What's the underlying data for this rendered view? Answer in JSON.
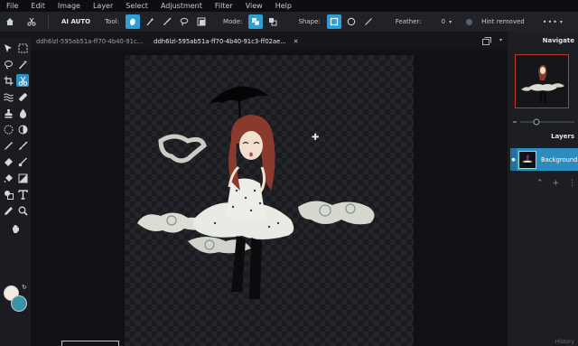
{
  "menu": [
    "File",
    "Edit",
    "Image",
    "Layer",
    "Select",
    "Adjustment",
    "Filter",
    "View",
    "Help"
  ],
  "options": {
    "ai_auto": "AI AUTO",
    "tool_label": "Tool:",
    "mode_label": "Mode:",
    "shape_label": "Shape:",
    "feather_label": "Feather:",
    "feather_value": "0",
    "hint_label": "Hint removed",
    "more": "•••"
  },
  "tabs": [
    {
      "label": "ddh6lzl-595ab51a-ff70-4b40-91c..."
    },
    {
      "label": "ddh6lzl-595ab51a-ff70-4b40-91c3-ff02ae...",
      "close": "✕"
    }
  ],
  "right_panel": {
    "navigate_title": "Navigate",
    "layers_title": "Layers",
    "layer_name": "Background",
    "history_title": "History"
  },
  "colors": {
    "accent": "#2f9fd3",
    "foreground": "#f3ece1",
    "background": "#3a94a7"
  }
}
